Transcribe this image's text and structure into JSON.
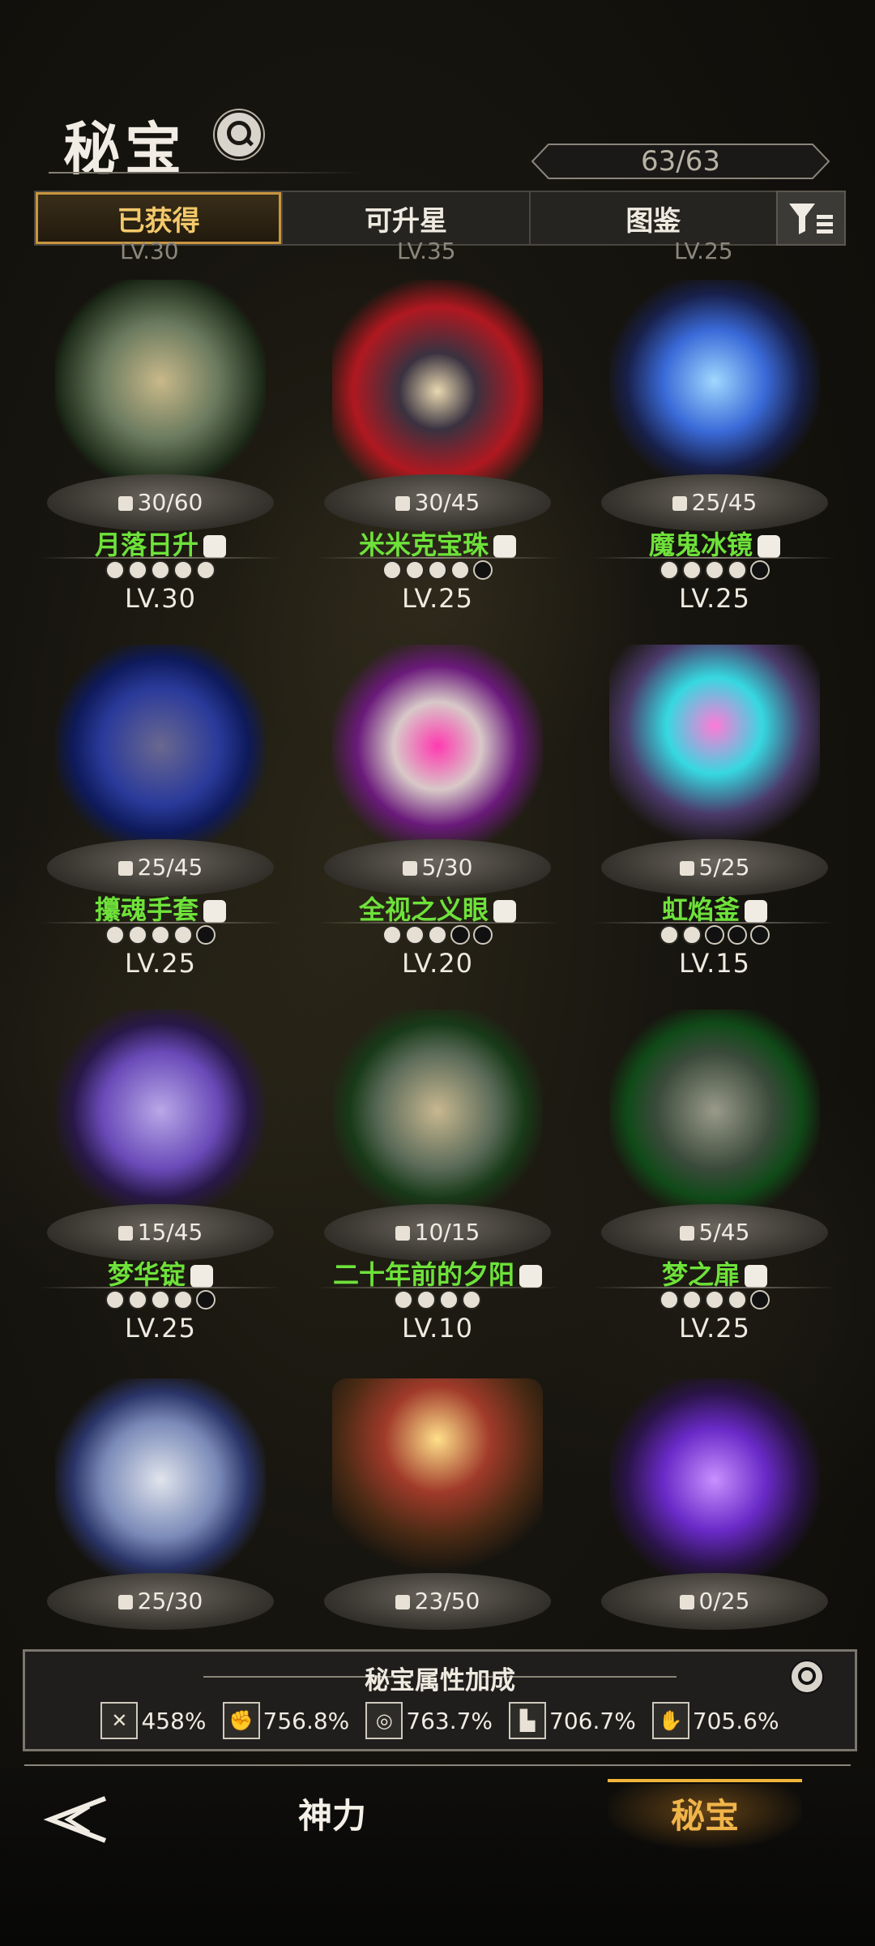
{
  "header": {
    "title": "秘宝",
    "count": "63/63"
  },
  "tabs": [
    {
      "label": "已获得",
      "active": true
    },
    {
      "label": "可升星",
      "active": false
    },
    {
      "label": "图鉴",
      "active": false
    }
  ],
  "partial_row": [
    "LV.30",
    "LV.35",
    "LV.25"
  ],
  "items": [
    {
      "name": "月落日升",
      "fragments": "30/60",
      "stars_filled": 5,
      "stars_total": 5,
      "level": "LV.30",
      "art": "shattered-glass-portrait"
    },
    {
      "name": "米米克宝珠",
      "fragments": "30/45",
      "stars_filled": 4,
      "stars_total": 5,
      "level": "LV.25",
      "art": "mimic-pearl"
    },
    {
      "name": "魔鬼冰镜",
      "fragments": "25/45",
      "stars_filled": 4,
      "stars_total": 5,
      "level": "LV.25",
      "art": "demon-ice-mirror"
    },
    {
      "name": "攥魂手套",
      "fragments": "25/45",
      "stars_filled": 4,
      "stars_total": 5,
      "level": "LV.25",
      "art": "soul-gauntlet"
    },
    {
      "name": "全视之义眼",
      "fragments": "5/30",
      "stars_filled": 3,
      "stars_total": 5,
      "level": "LV.20",
      "art": "all-seeing-eye"
    },
    {
      "name": "虹焰釜",
      "fragments": "5/25",
      "stars_filled": 2,
      "stars_total": 5,
      "level": "LV.15",
      "art": "rainbow-flame-cauldron"
    },
    {
      "name": "梦华锭",
      "fragments": "15/45",
      "stars_filled": 4,
      "stars_total": 5,
      "level": "LV.25",
      "art": "dream-ingot"
    },
    {
      "name": "二十年前的夕阳",
      "fragments": "10/15",
      "stars_filled": 4,
      "stars_total": 4,
      "level": "LV.10",
      "art": "shattered-sunset"
    },
    {
      "name": "梦之扉",
      "fragments": "5/45",
      "stars_filled": 4,
      "stars_total": 5,
      "level": "LV.25",
      "art": "dream-door"
    },
    {
      "name": "",
      "fragments": "25/30",
      "stars_filled": 0,
      "stars_total": 0,
      "level": "",
      "art": "silver-teapot"
    },
    {
      "name": "",
      "fragments": "23/50",
      "stars_filled": 0,
      "stars_total": 0,
      "level": "",
      "art": "melting-candle"
    },
    {
      "name": "",
      "fragments": "0/25",
      "stars_filled": 0,
      "stars_total": 0,
      "level": "",
      "art": "purple-lantern"
    }
  ],
  "bonus": {
    "title": "秘宝属性加成",
    "stats": [
      {
        "icon": "swords-icon",
        "value": "458%"
      },
      {
        "icon": "fist-icon",
        "value": "756.8%"
      },
      {
        "icon": "spiral-icon",
        "value": "763.7%"
      },
      {
        "icon": "boot-icon",
        "value": "706.7%"
      },
      {
        "icon": "hand-icon",
        "value": "705.6%"
      }
    ]
  },
  "nav": {
    "tab_power": "神力",
    "tab_treasure": "秘宝"
  },
  "colors": {
    "accent_gold": "#f0b44a",
    "name_green": "#6ee23a"
  }
}
